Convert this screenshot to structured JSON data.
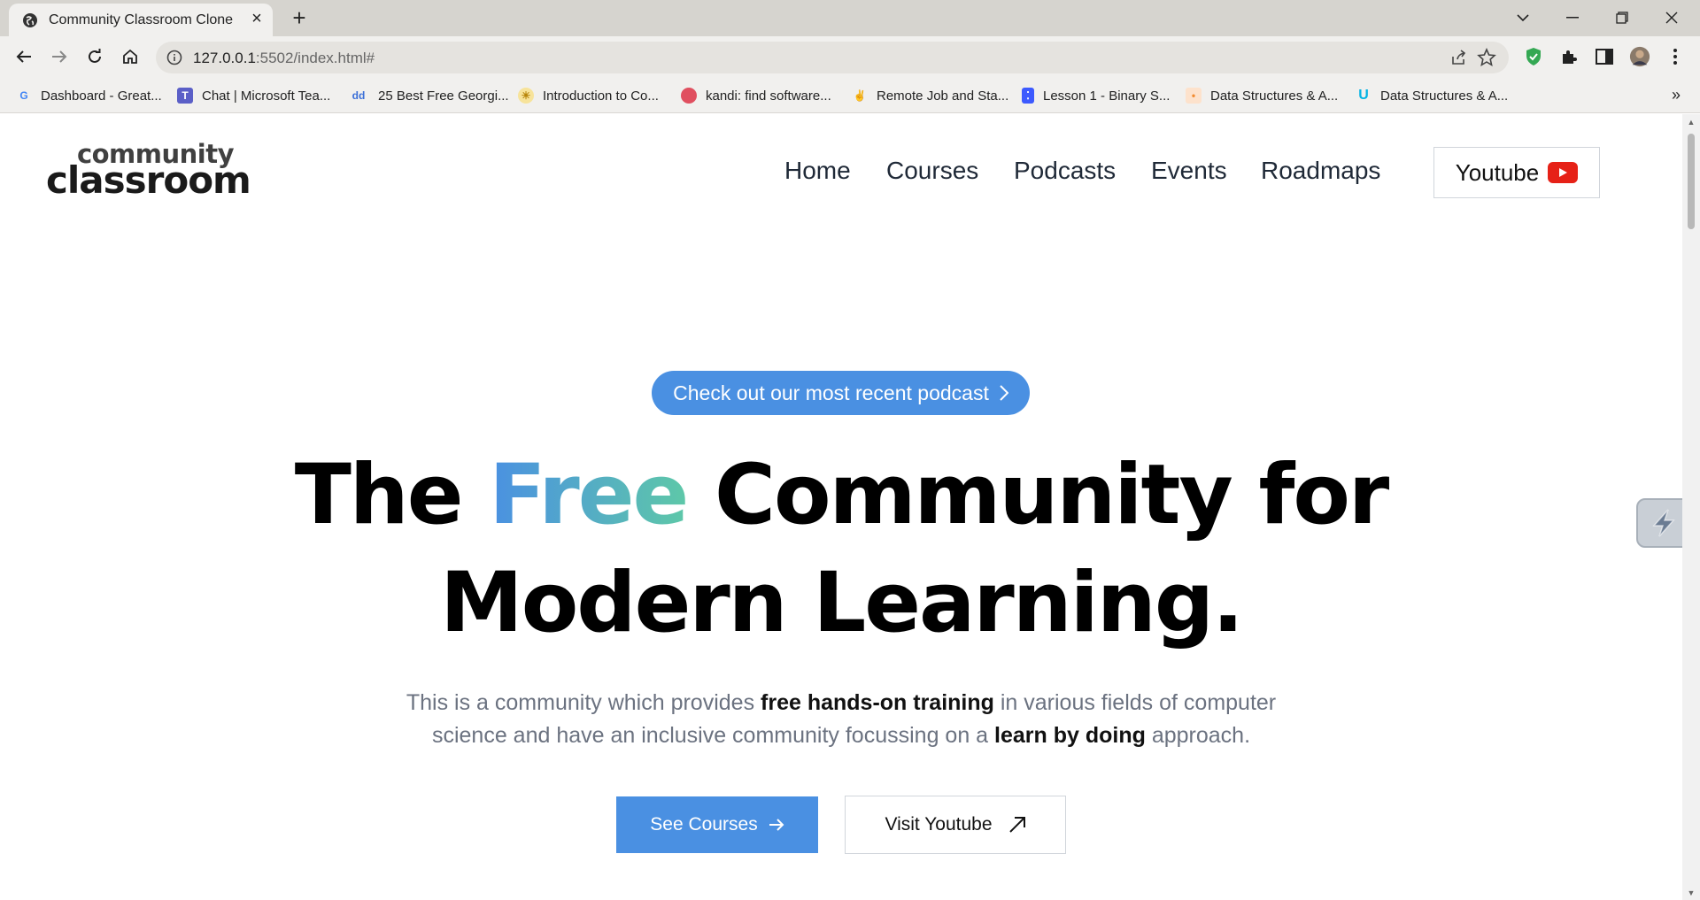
{
  "browser": {
    "tab_title": "Community Classroom Clone",
    "url_host": "127.0.0.1",
    "url_rest": ":5502/index.html#",
    "bookmarks": [
      {
        "label": "Dashboard - Great...",
        "icon": "google-icon",
        "color": "#4285f4"
      },
      {
        "label": "Chat | Microsoft Tea...",
        "icon": "teams-icon",
        "color": "#5b5fc7"
      },
      {
        "label": "25 Best Free Georgi...",
        "icon": "dd-icon",
        "color": "#3b6fd8"
      },
      {
        "label": "Introduction to Co...",
        "icon": "sun-icon",
        "color": "#f2c94c"
      },
      {
        "label": "kandi: find software...",
        "icon": "kandi-icon",
        "color": "#e04f5f"
      },
      {
        "label": "Remote Job and Sta...",
        "icon": "peace-icon",
        "color": "#444444"
      },
      {
        "label": "Lesson 1 - Binary S...",
        "icon": "dice-icon",
        "color": "#3d5afe"
      },
      {
        "label": "Data Structures & A...",
        "icon": "ds-icon",
        "color": "#f28b30"
      },
      {
        "label": "Data Structures & A...",
        "icon": "udacity-icon",
        "color": "#02b3e4"
      }
    ]
  },
  "site": {
    "logo_top": "community",
    "logo_bottom": "classroom",
    "nav": [
      "Home",
      "Courses",
      "Podcasts",
      "Events",
      "Roadmaps"
    ],
    "youtube_button": "Youtube",
    "podcast_pill": "Check out our most recent podcast",
    "headline": {
      "pre": "The ",
      "highlight": "Free",
      "post": " Community for",
      "line2": "Modern Learning."
    },
    "subtext": {
      "p1": "This is a community which provides ",
      "b1": "free hands-on training",
      "p2": " in various fields of computer science and have an inclusive community focussing on a ",
      "b2": "learn by doing",
      "p3": " approach."
    },
    "cta_courses": "See Courses",
    "cta_youtube": "Visit Youtube"
  },
  "colors": {
    "accent_blue": "#4a90e2",
    "accent_green": "#5ec8a8",
    "youtube_red": "#e62117"
  }
}
